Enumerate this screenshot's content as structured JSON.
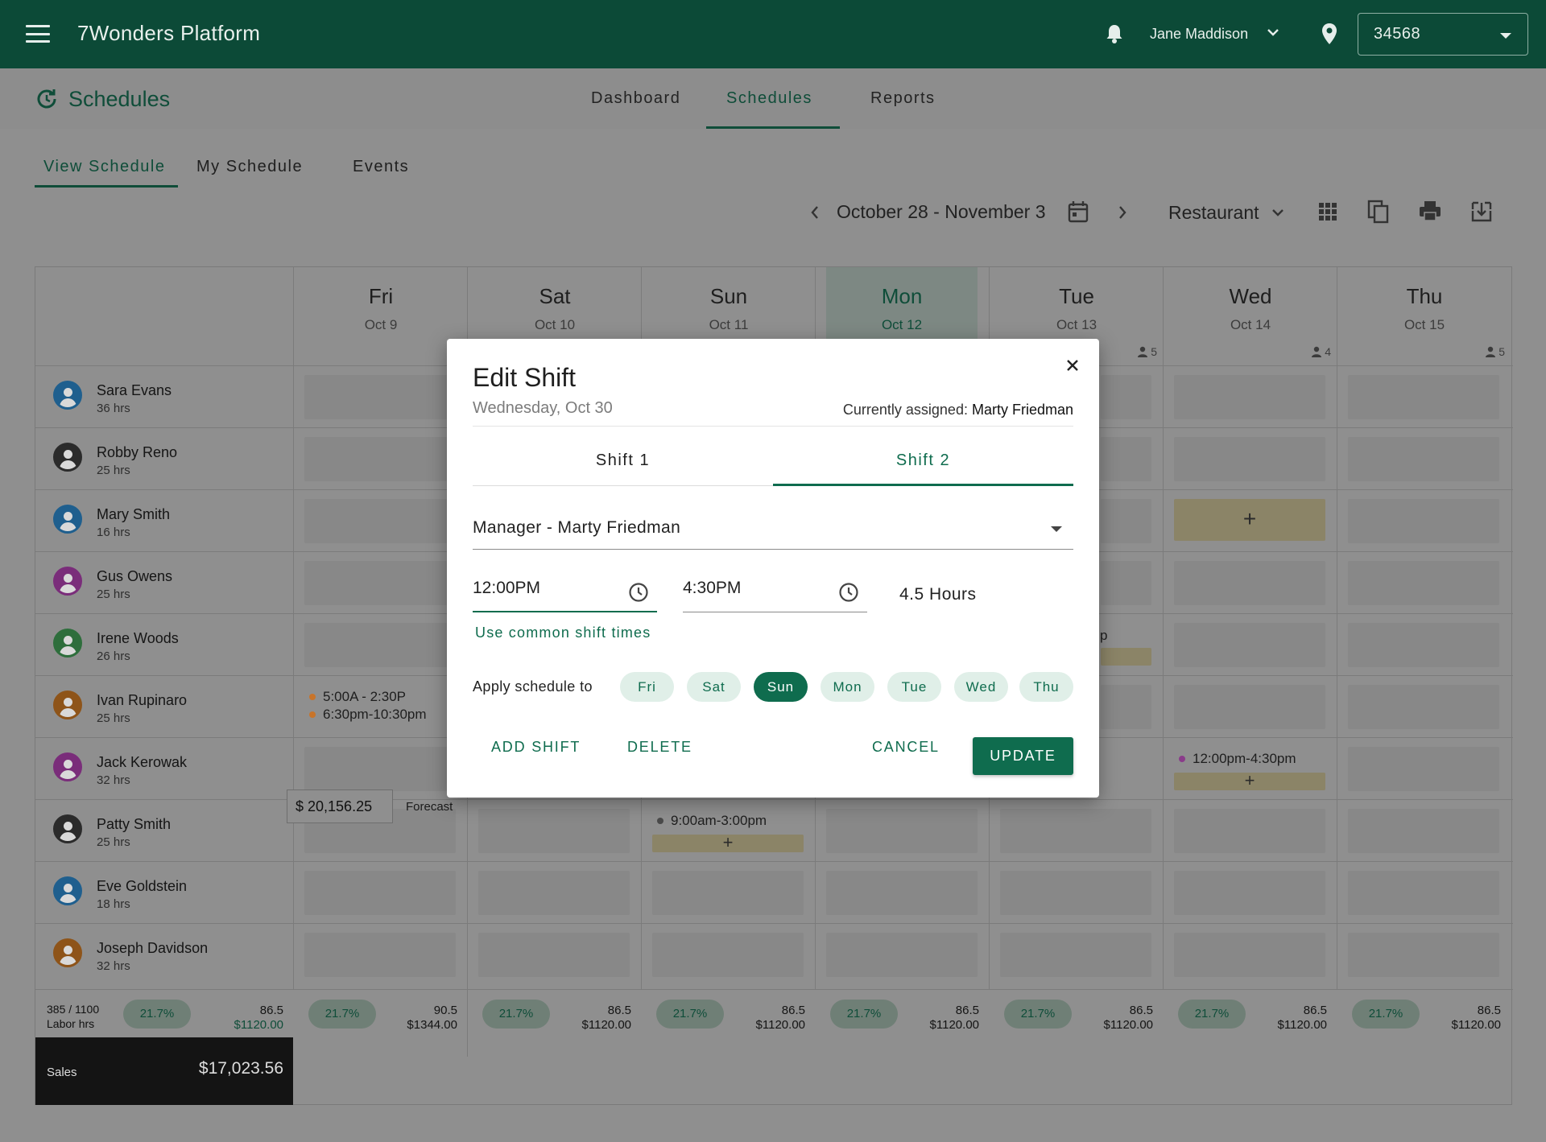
{
  "header": {
    "app_title": "7Wonders Platform",
    "user_name": "Jane Maddison",
    "store_id": "34568"
  },
  "nav": {
    "section_title": "Schedules",
    "tabs": [
      {
        "label": "Dashboard",
        "active": false
      },
      {
        "label": "Schedules",
        "active": true
      },
      {
        "label": "Reports",
        "active": false
      }
    ]
  },
  "subtabs": [
    {
      "label": "View Schedule",
      "active": true
    },
    {
      "label": "My Schedule",
      "active": false
    },
    {
      "label": "Events",
      "active": false
    }
  ],
  "toolbar": {
    "week_range": "October 28 - November 3",
    "location": "Restaurant"
  },
  "days": [
    {
      "name": "Fri",
      "date": "Oct 9",
      "count": "",
      "today": false
    },
    {
      "name": "Sat",
      "date": "Oct 10",
      "count": "",
      "today": false
    },
    {
      "name": "Sun",
      "date": "Oct 11",
      "count": "",
      "today": false
    },
    {
      "name": "Mon",
      "date": "Oct 12",
      "count": "",
      "today": true
    },
    {
      "name": "Tue",
      "date": "Oct 13",
      "count": "5",
      "today": false
    },
    {
      "name": "Wed",
      "date": "Oct 14",
      "count": "4",
      "today": false
    },
    {
      "name": "Thu",
      "date": "Oct 15",
      "count": "5",
      "today": false
    }
  ],
  "employees": [
    {
      "name": "Sara Evans",
      "hours": "36 hrs",
      "color": "#1f5f8e"
    },
    {
      "name": "Robby Reno",
      "hours": "25 hrs",
      "color": "#2b2b2b"
    },
    {
      "name": "Mary Smith",
      "hours": "16 hrs",
      "color": "#1f5f8e"
    },
    {
      "name": "Gus Owens",
      "hours": "25 hrs",
      "color": "#7a2d7a"
    },
    {
      "name": "Irene Woods",
      "hours": "26 hrs",
      "color": "#2e6e3c"
    },
    {
      "name": "Ivan Rupinaro",
      "hours": "25 hrs",
      "color": "#8e5419"
    },
    {
      "name": "Jack Kerowak",
      "hours": "32 hrs",
      "color": "#7a2d7a"
    },
    {
      "name": "Patty Smith",
      "hours": "25 hrs",
      "color": "#2b2b2b"
    },
    {
      "name": "Eve Goldstein",
      "hours": "18 hrs",
      "color": "#1f5f8e"
    },
    {
      "name": "Joseph Davidson",
      "hours": "32 hrs",
      "color": "#8e5419"
    }
  ],
  "shifts": {
    "ivan_fri_1": "5:00A - 2:30P",
    "ivan_fri_2": "6:30pm-10:30pm",
    "irene_tue_partial": "p",
    "jack_wed": "12:00pm-4:30pm",
    "patty_sun": "9:00am-3:00pm",
    "add_symbol": "+"
  },
  "totals": {
    "labor_hrs": "385 / 1100",
    "labor_label": "Labor hrs",
    "summary_pct": "21.7%",
    "summary_hrs": "86.5",
    "summary_money": "$1120.00",
    "days": [
      {
        "pct": "21.7%",
        "hrs": "90.5",
        "money": "$1344.00"
      },
      {
        "pct": "21.7%",
        "hrs": "86.5",
        "money": "$1120.00"
      },
      {
        "pct": "21.7%",
        "hrs": "86.5",
        "money": "$1120.00"
      },
      {
        "pct": "21.7%",
        "hrs": "86.5",
        "money": "$1120.00"
      },
      {
        "pct": "21.7%",
        "hrs": "86.5",
        "money": "$1120.00"
      },
      {
        "pct": "21.7%",
        "hrs": "86.5",
        "money": "$1120.00"
      },
      {
        "pct": "21.7%",
        "hrs": "86.5",
        "money": "$1120.00"
      }
    ],
    "sales_label": "Sales",
    "sales_value": "$17,023.56",
    "forecast_value": "$ 20,156.25",
    "forecast_label": "Forecast"
  },
  "modal": {
    "title": "Edit Shift",
    "date": "Wednesday, Oct 30",
    "assigned_prefix": "Currently assigned:",
    "assigned_name": "Marty Friedman",
    "tabs": [
      {
        "label": "Shift 1",
        "active": false
      },
      {
        "label": "Shift 2",
        "active": true
      }
    ],
    "role_value": "Manager - Marty Friedman",
    "start_time": "12:00PM",
    "end_time": "4:30PM",
    "duration": "4.5 Hours",
    "common_link": "Use common shift times",
    "apply_label": "Apply schedule to",
    "apply_days": [
      {
        "label": "Fri",
        "selected": false
      },
      {
        "label": "Sat",
        "selected": false
      },
      {
        "label": "Sun",
        "selected": true
      },
      {
        "label": "Mon",
        "selected": false
      },
      {
        "label": "Tue",
        "selected": false
      },
      {
        "label": "Wed",
        "selected": false
      },
      {
        "label": "Thu",
        "selected": false
      }
    ],
    "buttons": {
      "add_shift": "ADD SHIFT",
      "delete": "DELETE",
      "cancel": "CANCEL",
      "update": "UPDATE"
    }
  },
  "colors": {
    "brand": "#0c4a37",
    "accent": "#0f6c4e",
    "shift_orange": "#c8742a",
    "shift_purple": "#8a3b8a",
    "shift_gray": "#4a4a4a"
  }
}
